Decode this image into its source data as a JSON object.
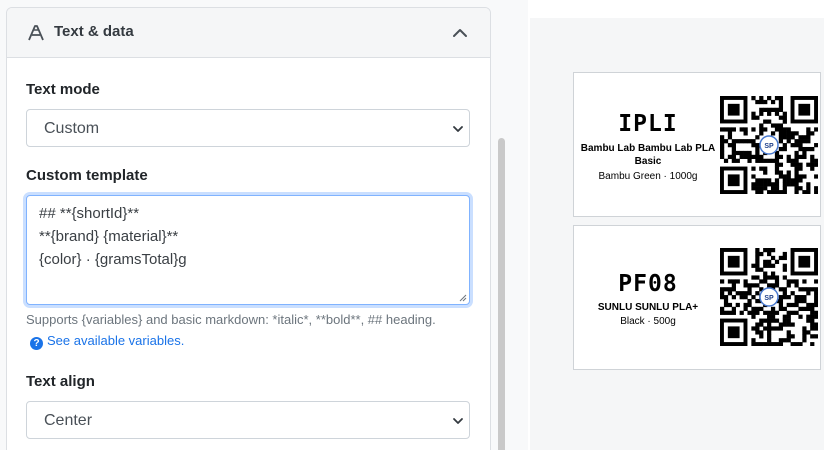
{
  "section": {
    "title": "Text & data",
    "icon": "font-letter-icon",
    "collapse_icon": "chevron-up-icon"
  },
  "text_mode": {
    "label": "Text mode",
    "value": "Custom"
  },
  "custom_template": {
    "label": "Custom template",
    "lines": [
      "## **{shortId}**",
      "**{brand} {material}**",
      "{color} · {gramsTotal}g"
    ]
  },
  "help": {
    "text": "Supports {variables} and basic markdown: *italic*, **bold**, ## heading.",
    "info_icon": "?",
    "link": "See available variables."
  },
  "text_align": {
    "label": "Text align",
    "value": "Center"
  },
  "preview": {
    "labels": [
      {
        "short_id": "IPLI",
        "brand_material": "Bambu Lab Bambu Lab PLA Basic",
        "color_weight": "Bambu Green · 1000g",
        "qr_badge": "SP"
      },
      {
        "short_id": "PF08",
        "brand_material": "SUNLU SUNLU PLA+",
        "color_weight": "Black · 500g",
        "qr_badge": "SP"
      }
    ]
  },
  "colors": {
    "accent": "#1a73e8",
    "focus_border": "#80b3ff"
  }
}
